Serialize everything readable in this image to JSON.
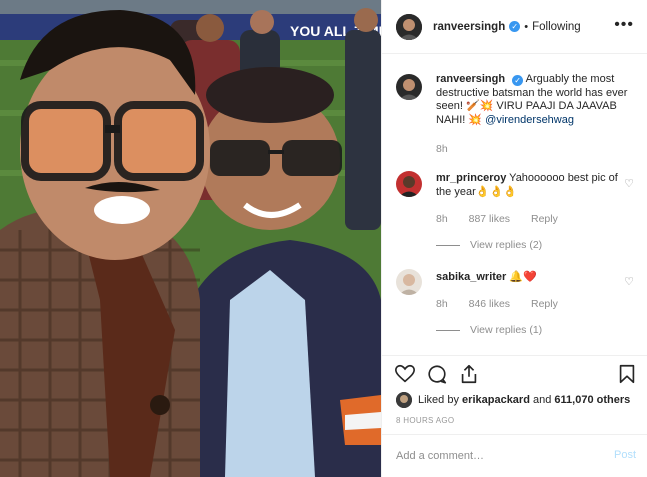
{
  "post": {
    "username": "ranveersingh",
    "follow_status": "Following",
    "more_label": "•••"
  },
  "caption": {
    "username": "ranveersingh",
    "text": "Arguably the most destructive batsman the world has ever seen! 🏏💥 VIRU PAAJI DA JAAVAB NAHI! 💥",
    "mention": "@virendersehwag",
    "time": "8h"
  },
  "comments": [
    {
      "username": "mr_princeroy",
      "text": "Yahoooooo best pic of the year👌👌👌",
      "time": "8h",
      "likes": "887 likes",
      "reply_label": "Reply",
      "view_replies": "View replies (2)"
    },
    {
      "username": "sabika_writer",
      "text": "🔔❤️",
      "time": "8h",
      "likes": "846 likes",
      "reply_label": "Reply",
      "view_replies": "View replies (1)"
    }
  ],
  "footer": {
    "liked_by_prefix": "Liked by",
    "liked_by_user": "erikapackard",
    "liked_by_and": "and",
    "liked_by_count": "611,070 others",
    "time_ago": "8 HOURS AGO",
    "add_comment_placeholder": "Add a comment…",
    "post_label": "Post"
  },
  "photo": {
    "banner_text": "YOU ALL TIME"
  },
  "icons": {
    "verified": "verified-badge-icon",
    "like": "heart-icon",
    "comment": "comment-icon",
    "share": "share-icon",
    "save": "bookmark-icon"
  },
  "colors": {
    "verified": "#3897f0",
    "muted": "#8e8e8e",
    "border": "#efefef",
    "post_disabled": "#b2dffc"
  }
}
